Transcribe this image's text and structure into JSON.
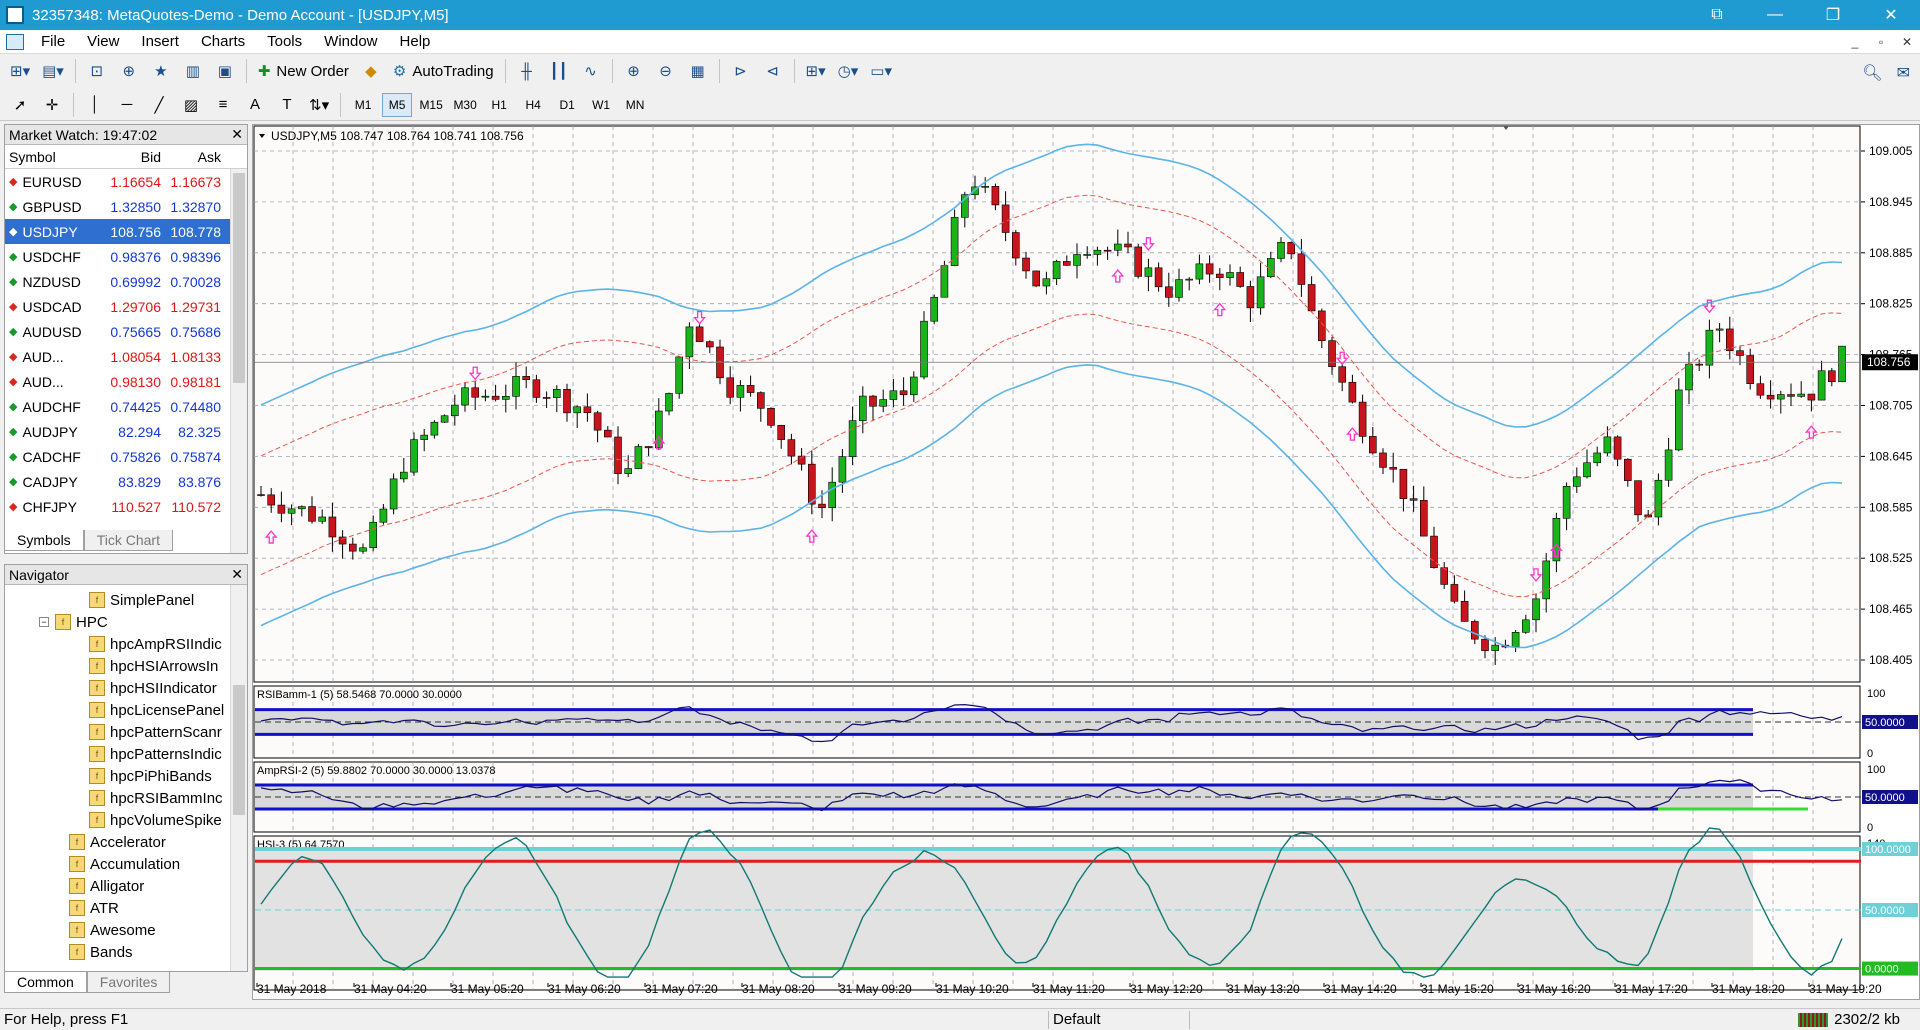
{
  "window": {
    "title": "32357348: MetaQuotes-Demo - Demo Account - [USDJPY,M5]"
  },
  "menu": [
    "File",
    "View",
    "Insert",
    "Charts",
    "Tools",
    "Window",
    "Help"
  ],
  "toolbar": {
    "new_order": "New Order",
    "autotrading": "AutoTrading"
  },
  "timeframes": [
    "M1",
    "M5",
    "M15",
    "M30",
    "H1",
    "H4",
    "D1",
    "W1",
    "MN"
  ],
  "active_timeframe": "M5",
  "market_watch": {
    "title": "Market Watch: 19:47:02",
    "columns": {
      "symbol": "Symbol",
      "bid": "Bid",
      "ask": "Ask"
    },
    "rows": [
      {
        "symbol": "EURUSD",
        "bid": "1.16654",
        "ask": "1.16673",
        "dir": "down",
        "color": "red"
      },
      {
        "symbol": "GBPUSD",
        "bid": "1.32850",
        "ask": "1.32870",
        "dir": "up",
        "color": "blue"
      },
      {
        "symbol": "USDJPY",
        "bid": "108.756",
        "ask": "108.778",
        "dir": "up",
        "color": "blue",
        "selected": true
      },
      {
        "symbol": "USDCHF",
        "bid": "0.98376",
        "ask": "0.98396",
        "dir": "up",
        "color": "blue"
      },
      {
        "symbol": "NZDUSD",
        "bid": "0.69992",
        "ask": "0.70028",
        "dir": "up",
        "color": "blue"
      },
      {
        "symbol": "USDCAD",
        "bid": "1.29706",
        "ask": "1.29731",
        "dir": "down",
        "color": "red"
      },
      {
        "symbol": "AUDUSD",
        "bid": "0.75665",
        "ask": "0.75686",
        "dir": "up",
        "color": "blue"
      },
      {
        "symbol": "AUD...",
        "bid": "1.08054",
        "ask": "1.08133",
        "dir": "down",
        "color": "red"
      },
      {
        "symbol": "AUD...",
        "bid": "0.98130",
        "ask": "0.98181",
        "dir": "down",
        "color": "red"
      },
      {
        "symbol": "AUDCHF",
        "bid": "0.74425",
        "ask": "0.74480",
        "dir": "up",
        "color": "blue"
      },
      {
        "symbol": "AUDJPY",
        "bid": "82.294",
        "ask": "82.325",
        "dir": "up",
        "color": "blue"
      },
      {
        "symbol": "CADCHF",
        "bid": "0.75826",
        "ask": "0.75874",
        "dir": "up",
        "color": "blue"
      },
      {
        "symbol": "CADJPY",
        "bid": "83.829",
        "ask": "83.876",
        "dir": "up",
        "color": "blue"
      },
      {
        "symbol": "CHFJPY",
        "bid": "110.527",
        "ask": "110.572",
        "dir": "down",
        "color": "red"
      }
    ],
    "tabs": [
      "Symbols",
      "Tick Chart"
    ]
  },
  "navigator": {
    "title": "Navigator",
    "items": [
      {
        "label": "SimplePanel",
        "level": 3
      },
      {
        "label": "HPC",
        "level": 2,
        "folder": true
      },
      {
        "label": "hpcAmpRSIIndic",
        "level": 3
      },
      {
        "label": "hpcHSIArrowsIn",
        "level": 3
      },
      {
        "label": "hpcHSIIndicator",
        "level": 3
      },
      {
        "label": "hpcLicensePanel",
        "level": 3
      },
      {
        "label": "hpcPatternScanr",
        "level": 3
      },
      {
        "label": "hpcPatternsIndic",
        "level": 3
      },
      {
        "label": "hpcPiPhiBands",
        "level": 3
      },
      {
        "label": "hpcRSIBammInc",
        "level": 3
      },
      {
        "label": "hpcVolumeSpike",
        "level": 3
      },
      {
        "label": "Accelerator",
        "level": 2
      },
      {
        "label": "Accumulation",
        "level": 2
      },
      {
        "label": "Alligator",
        "level": 2
      },
      {
        "label": "ATR",
        "level": 2
      },
      {
        "label": "Awesome",
        "level": 2
      },
      {
        "label": "Bands",
        "level": 2
      }
    ],
    "tabs": [
      "Common",
      "Favorites"
    ]
  },
  "chart": {
    "header": "USDJPY,M5  108.747 108.764 108.741 108.756",
    "price_labels": [
      "109.005",
      "108.945",
      "108.885",
      "108.825",
      "108.765",
      "108.705",
      "108.645",
      "108.585",
      "108.525",
      "108.465",
      "108.405"
    ],
    "current_price": "108.756",
    "time_labels": [
      "31 May 2018",
      "31 May 04:20",
      "31 May 05:20",
      "31 May 06:20",
      "31 May 07:20",
      "31 May 08:20",
      "31 May 09:20",
      "31 May 10:20",
      "31 May 11:20",
      "31 May 12:20",
      "31 May 13:20",
      "31 May 14:20",
      "31 May 15:20",
      "31 May 16:20",
      "31 May 17:20",
      "31 May 18:20",
      "31 May 19:20"
    ],
    "indicators": [
      {
        "label": "RSIBamm-1 (5) 58.5468 70.0000 30.0000",
        "axis_top": "100",
        "axis_mid": "50.0000",
        "axis_bottom": "0"
      },
      {
        "label": "AmpRSI-2 (5) 59.8802 70.0000 30.0000 13.0378",
        "axis_top": "100",
        "axis_mid": "50.0000",
        "axis_bottom": "0"
      },
      {
        "label": "HSI-3 (5) 64.7570",
        "axis_top": "140",
        "axis_hi": "100.0000",
        "axis_mid": "50.0000",
        "axis_lo": "0.0000"
      }
    ],
    "colors": {
      "bull": "#19b419",
      "bear": "#c8151b",
      "band": "#5ab4e6",
      "mid": "#e8584a",
      "arrow": "#ff33cc"
    }
  },
  "status": {
    "help": "For Help, press F1",
    "profile": "Default",
    "traffic": "2302/2 kb"
  }
}
